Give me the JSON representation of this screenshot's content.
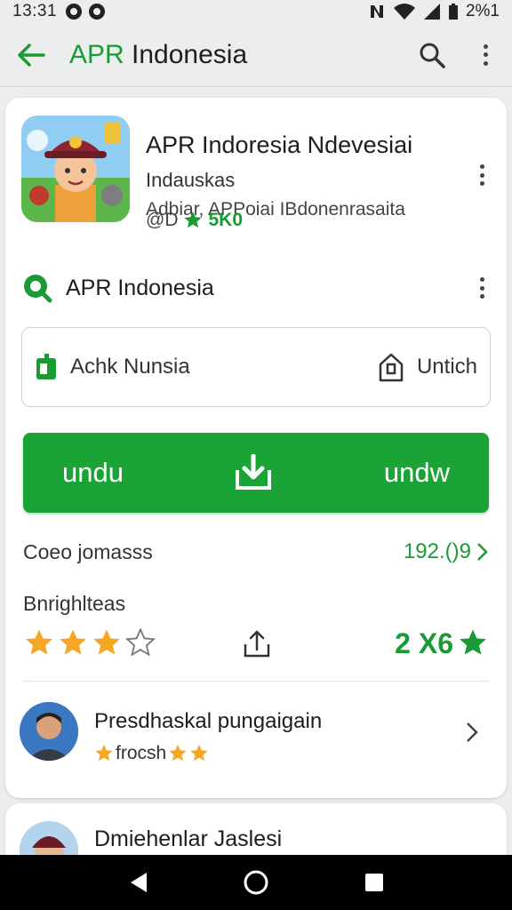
{
  "status_bar": {
    "time": "13:31",
    "battery": "2%1"
  },
  "app_bar": {
    "title_accent": "APR",
    "title_rest": "Indonesia"
  },
  "app": {
    "name": "APR Indoresia Ndevesiai",
    "subtitle": "Indauskas",
    "developer": "Adbiar, APPoiai IBdonenrasaita",
    "rating_prefix": "@D",
    "rating_value": "5K0"
  },
  "section": {
    "label": "APR Indonesia"
  },
  "options": {
    "left_label": "Achk Nunsia",
    "right_label": "Untich"
  },
  "download": {
    "left_label": "undu",
    "right_label": "undw"
  },
  "info": {
    "label": "Coeo jomasss",
    "value": "192.()9"
  },
  "rating": {
    "title": "Bnrighlteas",
    "stars_filled": 3,
    "stars_total": 4,
    "count": "2 X6"
  },
  "review": {
    "title": "Presdhaskal pungaigain",
    "meta": "frocsh"
  },
  "next_review": {
    "title": "Dmiehenlar Jaslesi"
  },
  "colors": {
    "accent": "#1a9a35",
    "button": "#1aa436",
    "star": "#f5a623"
  },
  "icons": [
    "back-arrow-icon",
    "search-icon",
    "more-vert-icon",
    "download-icon",
    "share-icon",
    "star-icon",
    "chevron-right-icon"
  ]
}
